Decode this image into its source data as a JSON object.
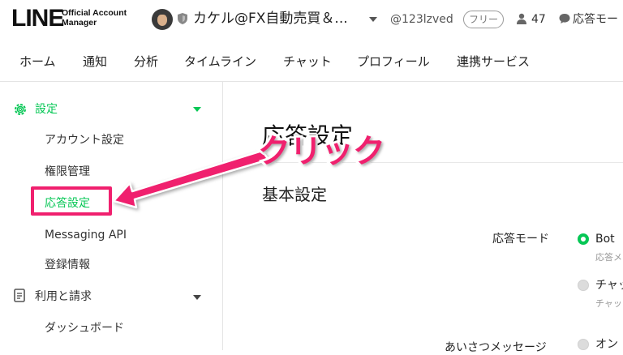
{
  "header": {
    "logo_main": "LINE",
    "logo_sub_line1": "Official Account",
    "logo_sub_line2": "Manager",
    "account_name": "カケル@FX自動売買＆...",
    "account_id": "@123lzved",
    "plan_badge": "フリー",
    "friends_count": "47",
    "chat_mode": "応答モー"
  },
  "nav": {
    "items": [
      "ホーム",
      "通知",
      "分析",
      "タイムライン",
      "チャット",
      "プロフィール",
      "連携サービス"
    ]
  },
  "sidebar": {
    "settings_title": "設定",
    "settings_items": [
      "アカウント設定",
      "権限管理",
      "応答設定",
      "Messaging API",
      "登録情報"
    ],
    "billing_title": "利用と請求",
    "billing_items": [
      "ダッシュボード"
    ]
  },
  "main": {
    "page_title": "応答設定",
    "section_title": "基本設定",
    "response_mode_label": "応答モード",
    "response_mode_options": [
      {
        "label": "Bot",
        "sub": "応答メ",
        "selected": true
      },
      {
        "label": "チャッ",
        "sub": "チャッ",
        "selected": false
      }
    ],
    "greeting_label": "あいさつメッセージ",
    "greeting_option": "オン"
  },
  "annotation": {
    "callout_text": "クリック",
    "color": "#f0206e"
  },
  "colors": {
    "brand_green": "#06c755",
    "annotation_pink": "#f0206e"
  }
}
